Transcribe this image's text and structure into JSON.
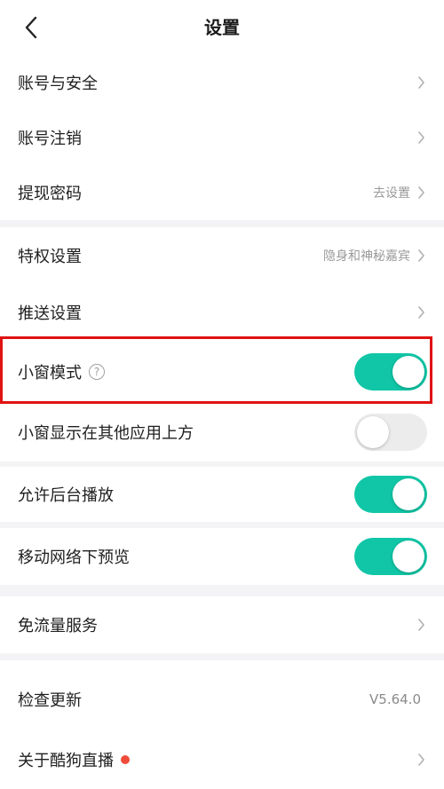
{
  "header": {
    "title": "设置",
    "back_icon": "chevron-left-icon"
  },
  "section1": {
    "items": [
      {
        "label": "账号与安全",
        "value": ""
      },
      {
        "label": "账号注销",
        "value": ""
      },
      {
        "label": "提现密码",
        "value": "去设置"
      }
    ]
  },
  "section2": {
    "items": [
      {
        "label": "特权设置",
        "value": "隐身和神秘嘉宾"
      },
      {
        "label": "推送设置",
        "value": ""
      }
    ],
    "toggles": [
      {
        "label": "小窗模式",
        "on": true,
        "help_icon": "question-circle-icon"
      },
      {
        "label": "小窗显示在其他应用上方",
        "on": false
      }
    ]
  },
  "section3": {
    "toggles": [
      {
        "label": "允许后台播放",
        "on": true
      }
    ]
  },
  "section4": {
    "toggles": [
      {
        "label": "移动网络下预览",
        "on": true
      }
    ]
  },
  "section5": {
    "items": [
      {
        "label": "免流量服务",
        "value": ""
      }
    ]
  },
  "section6": {
    "items": [
      {
        "label": "检查更新",
        "value": "V5.64.0"
      },
      {
        "label": "关于酷狗直播",
        "value": "",
        "badge": "red-dot"
      }
    ]
  },
  "colors": {
    "toggle_on": "#10c6a6",
    "toggle_off": "#ececec",
    "highlight": "#e01212",
    "badge": "#f04b3a"
  }
}
